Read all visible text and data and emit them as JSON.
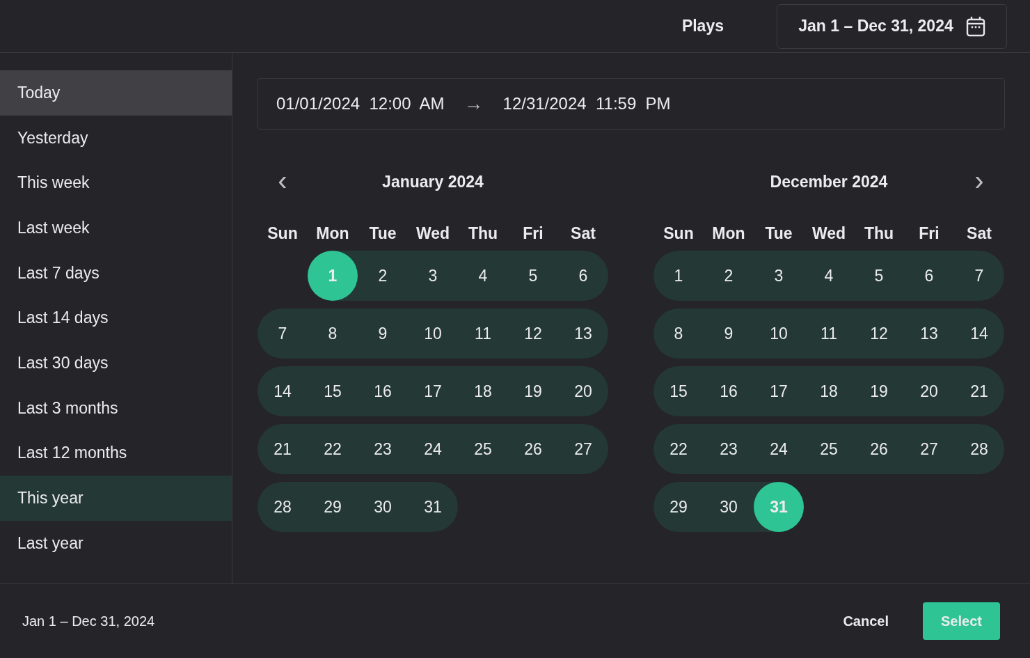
{
  "header": {
    "metric": "Plays",
    "range_button": "Jan 1 – Dec 31, 2024"
  },
  "presets": [
    {
      "label": "Today",
      "selected": false,
      "focused": true
    },
    {
      "label": "Yesterday",
      "selected": false,
      "focused": false
    },
    {
      "label": "This week",
      "selected": false,
      "focused": false
    },
    {
      "label": "Last week",
      "selected": false,
      "focused": false
    },
    {
      "label": "Last 7 days",
      "selected": false,
      "focused": false
    },
    {
      "label": "Last 14 days",
      "selected": false,
      "focused": false
    },
    {
      "label": "Last 30 days",
      "selected": false,
      "focused": false
    },
    {
      "label": "Last 3 months",
      "selected": false,
      "focused": false
    },
    {
      "label": "Last 12 months",
      "selected": false,
      "focused": false
    },
    {
      "label": "This year",
      "selected": true,
      "focused": false
    },
    {
      "label": "Last year",
      "selected": false,
      "focused": false
    }
  ],
  "range_input": {
    "start": "01/01/2024  12:00  AM",
    "separator": "→",
    "end": "12/31/2024  11:59  PM"
  },
  "nav": {
    "previous": "‹",
    "next": "›"
  },
  "calendars": [
    {
      "title": "January 2024",
      "weekdays": [
        "Sun",
        "Mon",
        "Tue",
        "Wed",
        "Thu",
        "Fri",
        "Sat"
      ],
      "weeks": [
        {
          "days": [
            {
              "kind": "blank"
            },
            {
              "kind": "day",
              "label": "1",
              "in_range": true,
              "selected": true
            },
            {
              "kind": "day",
              "label": "2",
              "in_range": true,
              "selected": false
            },
            {
              "kind": "day",
              "label": "3",
              "in_range": true,
              "selected": false
            },
            {
              "kind": "day",
              "label": "4",
              "in_range": true,
              "selected": false
            },
            {
              "kind": "day",
              "label": "5",
              "in_range": true,
              "selected": false
            },
            {
              "kind": "day",
              "label": "6",
              "in_range": true,
              "selected": false
            }
          ]
        },
        {
          "days": [
            {
              "kind": "day",
              "label": "7",
              "in_range": true,
              "selected": false
            },
            {
              "kind": "day",
              "label": "8",
              "in_range": true,
              "selected": false
            },
            {
              "kind": "day",
              "label": "9",
              "in_range": true,
              "selected": false
            },
            {
              "kind": "day",
              "label": "10",
              "in_range": true,
              "selected": false
            },
            {
              "kind": "day",
              "label": "11",
              "in_range": true,
              "selected": false
            },
            {
              "kind": "day",
              "label": "12",
              "in_range": true,
              "selected": false
            },
            {
              "kind": "day",
              "label": "13",
              "in_range": true,
              "selected": false
            }
          ]
        },
        {
          "days": [
            {
              "kind": "day",
              "label": "14",
              "in_range": true,
              "selected": false
            },
            {
              "kind": "day",
              "label": "15",
              "in_range": true,
              "selected": false
            },
            {
              "kind": "day",
              "label": "16",
              "in_range": true,
              "selected": false
            },
            {
              "kind": "day",
              "label": "17",
              "in_range": true,
              "selected": false
            },
            {
              "kind": "day",
              "label": "18",
              "in_range": true,
              "selected": false
            },
            {
              "kind": "day",
              "label": "19",
              "in_range": true,
              "selected": false
            },
            {
              "kind": "day",
              "label": "20",
              "in_range": true,
              "selected": false
            }
          ]
        },
        {
          "days": [
            {
              "kind": "day",
              "label": "21",
              "in_range": true,
              "selected": false
            },
            {
              "kind": "day",
              "label": "22",
              "in_range": true,
              "selected": false
            },
            {
              "kind": "day",
              "label": "23",
              "in_range": true,
              "selected": false
            },
            {
              "kind": "day",
              "label": "24",
              "in_range": true,
              "selected": false
            },
            {
              "kind": "day",
              "label": "25",
              "in_range": true,
              "selected": false
            },
            {
              "kind": "day",
              "label": "26",
              "in_range": true,
              "selected": false
            },
            {
              "kind": "day",
              "label": "27",
              "in_range": true,
              "selected": false
            }
          ]
        },
        {
          "days": [
            {
              "kind": "day",
              "label": "28",
              "in_range": true,
              "selected": false
            },
            {
              "kind": "day",
              "label": "29",
              "in_range": true,
              "selected": false
            },
            {
              "kind": "day",
              "label": "30",
              "in_range": true,
              "selected": false
            },
            {
              "kind": "day",
              "label": "31",
              "in_range": true,
              "selected": false
            }
          ]
        }
      ]
    },
    {
      "title": "December 2024",
      "weekdays": [
        "Sun",
        "Mon",
        "Tue",
        "Wed",
        "Thu",
        "Fri",
        "Sat"
      ],
      "weeks": [
        {
          "days": [
            {
              "kind": "day",
              "label": "1",
              "in_range": true,
              "selected": false
            },
            {
              "kind": "day",
              "label": "2",
              "in_range": true,
              "selected": false
            },
            {
              "kind": "day",
              "label": "3",
              "in_range": true,
              "selected": false
            },
            {
              "kind": "day",
              "label": "4",
              "in_range": true,
              "selected": false
            },
            {
              "kind": "day",
              "label": "5",
              "in_range": true,
              "selected": false
            },
            {
              "kind": "day",
              "label": "6",
              "in_range": true,
              "selected": false
            },
            {
              "kind": "day",
              "label": "7",
              "in_range": true,
              "selected": false
            }
          ]
        },
        {
          "days": [
            {
              "kind": "day",
              "label": "8",
              "in_range": true,
              "selected": false
            },
            {
              "kind": "day",
              "label": "9",
              "in_range": true,
              "selected": false
            },
            {
              "kind": "day",
              "label": "10",
              "in_range": true,
              "selected": false
            },
            {
              "kind": "day",
              "label": "11",
              "in_range": true,
              "selected": false
            },
            {
              "kind": "day",
              "label": "12",
              "in_range": true,
              "selected": false
            },
            {
              "kind": "day",
              "label": "13",
              "in_range": true,
              "selected": false
            },
            {
              "kind": "day",
              "label": "14",
              "in_range": true,
              "selected": false
            }
          ]
        },
        {
          "days": [
            {
              "kind": "day",
              "label": "15",
              "in_range": true,
              "selected": false
            },
            {
              "kind": "day",
              "label": "16",
              "in_range": true,
              "selected": false
            },
            {
              "kind": "day",
              "label": "17",
              "in_range": true,
              "selected": false
            },
            {
              "kind": "day",
              "label": "18",
              "in_range": true,
              "selected": false
            },
            {
              "kind": "day",
              "label": "19",
              "in_range": true,
              "selected": false
            },
            {
              "kind": "day",
              "label": "20",
              "in_range": true,
              "selected": false
            },
            {
              "kind": "day",
              "label": "21",
              "in_range": true,
              "selected": false
            }
          ]
        },
        {
          "days": [
            {
              "kind": "day",
              "label": "22",
              "in_range": true,
              "selected": false
            },
            {
              "kind": "day",
              "label": "23",
              "in_range": true,
              "selected": false
            },
            {
              "kind": "day",
              "label": "24",
              "in_range": true,
              "selected": false
            },
            {
              "kind": "day",
              "label": "25",
              "in_range": true,
              "selected": false
            },
            {
              "kind": "day",
              "label": "26",
              "in_range": true,
              "selected": false
            },
            {
              "kind": "day",
              "label": "27",
              "in_range": true,
              "selected": false
            },
            {
              "kind": "day",
              "label": "28",
              "in_range": true,
              "selected": false
            }
          ]
        },
        {
          "days": [
            {
              "kind": "day",
              "label": "29",
              "in_range": true,
              "selected": false
            },
            {
              "kind": "day",
              "label": "30",
              "in_range": true,
              "selected": false
            },
            {
              "kind": "day",
              "label": "31",
              "in_range": true,
              "selected": true
            }
          ]
        }
      ]
    }
  ],
  "footer": {
    "summary": "Jan 1 – Dec 31, 2024",
    "buttons": [
      {
        "label": "Cancel",
        "kind": "secondary"
      },
      {
        "label": "Select",
        "kind": "primary"
      }
    ]
  }
}
